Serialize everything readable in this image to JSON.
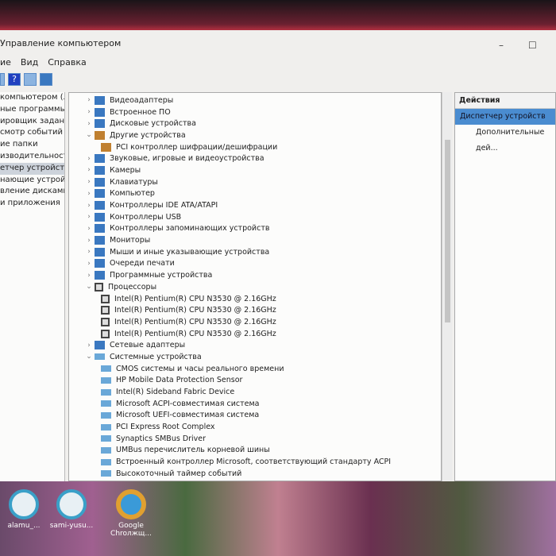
{
  "window": {
    "title": "Управление компьютером",
    "min": "–",
    "max": "☐"
  },
  "menu": [
    "ие",
    "Вид",
    "Справка"
  ],
  "left_nav": [
    "компьютером (л",
    "ные программы",
    "ировщик заданий",
    "смотр событий",
    "ие папки",
    "изводительность",
    "етчер устройств",
    "нающие устройст",
    "вление дисками",
    "и приложения"
  ],
  "tree": [
    {
      "chev": "›",
      "label": "Видеоадаптеры",
      "kind": "cat",
      "indent": 0
    },
    {
      "chev": "›",
      "label": "Встроенное ПО",
      "kind": "cat",
      "indent": 0
    },
    {
      "chev": "›",
      "label": "Дисковые устройства",
      "kind": "cat",
      "indent": 0
    },
    {
      "chev": "⌄",
      "label": "Другие устройства",
      "kind": "warn",
      "indent": 0
    },
    {
      "chev": "",
      "label": "PCI контроллер шифрации/дешифрации",
      "kind": "warn",
      "indent": 1
    },
    {
      "chev": "›",
      "label": "Звуковые, игровые и видеоустройства",
      "kind": "cat",
      "indent": 0
    },
    {
      "chev": "›",
      "label": "Камеры",
      "kind": "cat",
      "indent": 0
    },
    {
      "chev": "›",
      "label": "Клавиатуры",
      "kind": "cat",
      "indent": 0
    },
    {
      "chev": "›",
      "label": "Компьютер",
      "kind": "cat",
      "indent": 0
    },
    {
      "chev": "›",
      "label": "Контроллеры IDE ATA/ATAPI",
      "kind": "cat",
      "indent": 0
    },
    {
      "chev": "›",
      "label": "Контроллеры USB",
      "kind": "cat",
      "indent": 0
    },
    {
      "chev": "›",
      "label": "Контроллеры запоминающих устройств",
      "kind": "cat",
      "indent": 0
    },
    {
      "chev": "›",
      "label": "Мониторы",
      "kind": "cat",
      "indent": 0
    },
    {
      "chev": "›",
      "label": "Мыши и иные указывающие устройства",
      "kind": "cat",
      "indent": 0
    },
    {
      "chev": "›",
      "label": "Очереди печати",
      "kind": "cat",
      "indent": 0
    },
    {
      "chev": "›",
      "label": "Программные устройства",
      "kind": "cat",
      "indent": 0
    },
    {
      "chev": "⌄",
      "label": "Процессоры",
      "kind": "cpu",
      "indent": 0
    },
    {
      "chev": "",
      "label": "Intel(R) Pentium(R) CPU  N3530  @ 2.16GHz",
      "kind": "cpu",
      "indent": 1
    },
    {
      "chev": "",
      "label": "Intel(R) Pentium(R) CPU  N3530  @ 2.16GHz",
      "kind": "cpu",
      "indent": 1
    },
    {
      "chev": "",
      "label": "Intel(R) Pentium(R) CPU  N3530  @ 2.16GHz",
      "kind": "cpu",
      "indent": 1
    },
    {
      "chev": "",
      "label": "Intel(R) Pentium(R) CPU  N3530  @ 2.16GHz",
      "kind": "cpu",
      "indent": 1
    },
    {
      "chev": "›",
      "label": "Сетевые адаптеры",
      "kind": "cat",
      "indent": 0
    },
    {
      "chev": "⌄",
      "label": "Системные устройства",
      "kind": "sys",
      "indent": 0
    },
    {
      "chev": "",
      "label": "CMOS системы и часы реального времени",
      "kind": "sys",
      "indent": 1
    },
    {
      "chev": "",
      "label": "HP Mobile Data Protection Sensor",
      "kind": "sys",
      "indent": 1
    },
    {
      "chev": "",
      "label": "Intel(R) Sideband Fabric Device",
      "kind": "sys",
      "indent": 1
    },
    {
      "chev": "",
      "label": "Microsoft ACPI-совместимая система",
      "kind": "sys",
      "indent": 1
    },
    {
      "chev": "",
      "label": "Microsoft UEFI-совместимая система",
      "kind": "sys",
      "indent": 1
    },
    {
      "chev": "",
      "label": "PCI Express Root Complex",
      "kind": "sys",
      "indent": 1
    },
    {
      "chev": "",
      "label": "Synaptics SMBus Driver",
      "kind": "sys",
      "indent": 1
    },
    {
      "chev": "",
      "label": "UMBus перечислитель корневой шины",
      "kind": "sys",
      "indent": 1
    },
    {
      "chev": "",
      "label": "Встроенный контроллер Microsoft, соответствующий стандарту ACPI",
      "kind": "sys",
      "indent": 1
    },
    {
      "chev": "",
      "label": "Высокоточный таймер событий",
      "kind": "sys",
      "indent": 1
    }
  ],
  "actions": {
    "header": "Действия",
    "selected": "Диспетчер устройств",
    "more": "Дополнительные дей..."
  },
  "desktop": [
    {
      "label": "alamu_...",
      "color": "#e8f0f4"
    },
    {
      "label": "sami-yusu...",
      "color": "#e8f0f4"
    },
    {
      "label": "Google Chroлжщ...",
      "color": "#3a9ad8"
    }
  ]
}
